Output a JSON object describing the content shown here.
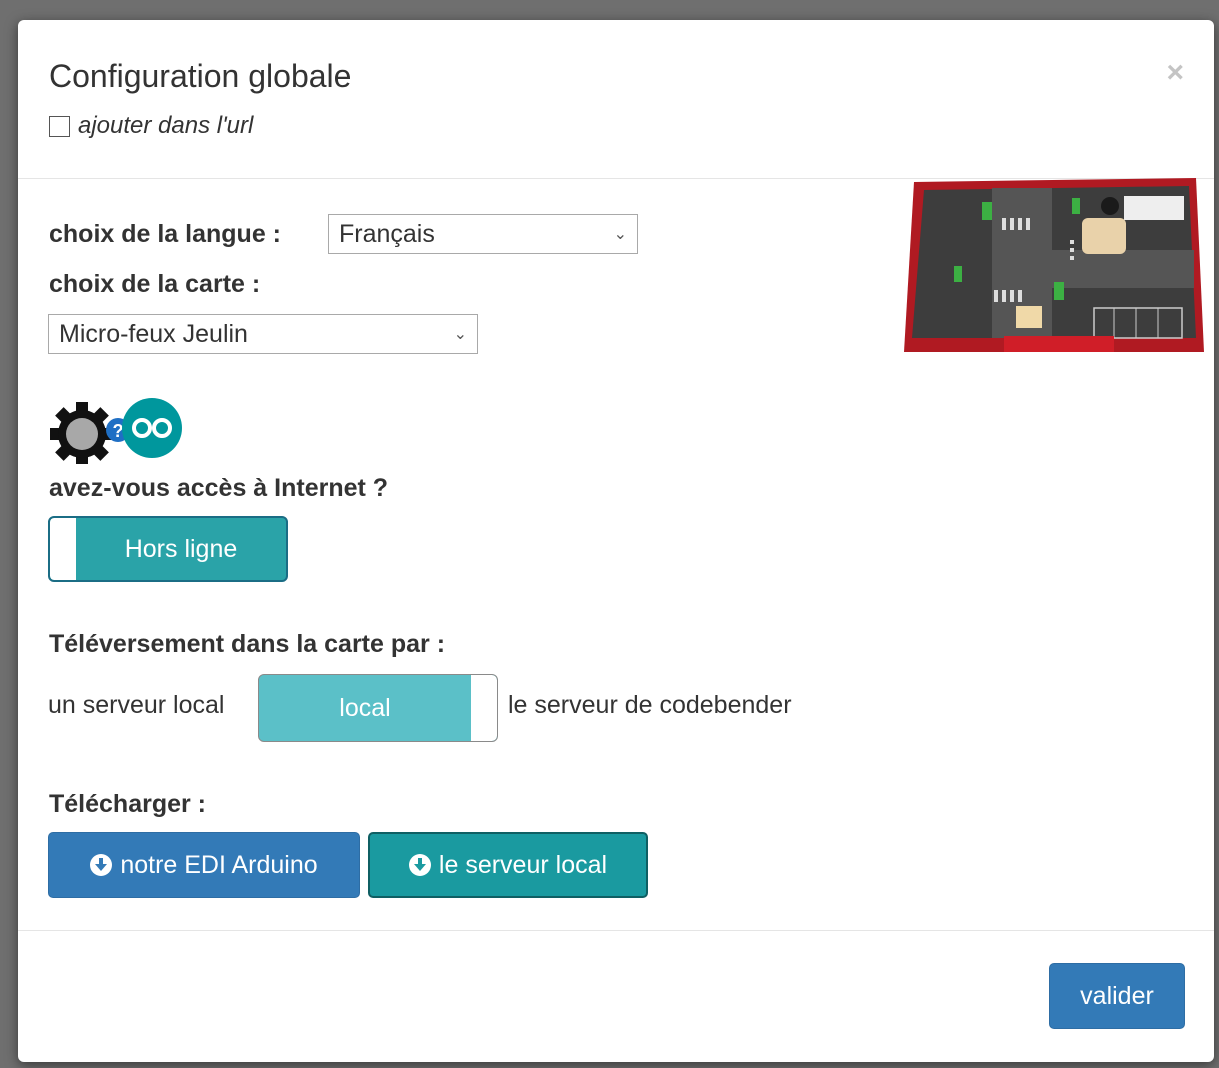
{
  "dialog": {
    "title": "Configuration globale",
    "close_label": "×",
    "url_checkbox_label": "ajouter dans l'url"
  },
  "language": {
    "label": "choix de la langue :",
    "selected": "Français"
  },
  "board": {
    "label": "choix de la carte :",
    "selected": "Micro-feux Jeulin",
    "image_icon": "board-photo"
  },
  "internet": {
    "question": "avez-vous accès à Internet ?",
    "toggle_label": "Hors ligne"
  },
  "upload": {
    "heading": "Téléversement dans la carte par :",
    "left_option": "un serveur local",
    "toggle_label": "local",
    "right_option": "le serveur de codebender"
  },
  "download": {
    "heading": "Télécharger :",
    "ide_button": "notre EDI Arduino",
    "server_button": "le serveur local"
  },
  "footer": {
    "validate_button": "valider"
  },
  "colors": {
    "primary": "#337ab7",
    "teal": "#1a9aa0",
    "teal_light": "#5bc0c8"
  }
}
